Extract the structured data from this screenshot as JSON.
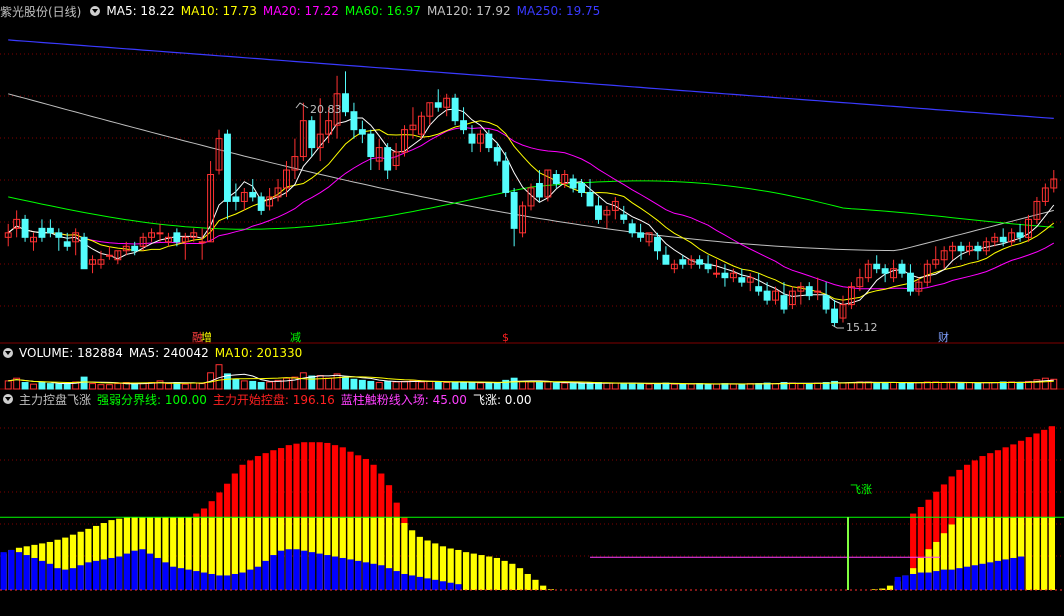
{
  "price_header": {
    "title": "紫光股份(日线)",
    "ma": [
      {
        "label": "MA5: 18.22",
        "color": "#ffffff"
      },
      {
        "label": "MA10: 17.73",
        "color": "#ffff00"
      },
      {
        "label": "MA20: 17.22",
        "color": "#ff00ff"
      },
      {
        "label": "MA60: 16.97",
        "color": "#00ff00"
      },
      {
        "label": "MA120: 17.92",
        "color": "#c0c0c0"
      },
      {
        "label": "MA250: 19.75",
        "color": "#3a3aff"
      }
    ]
  },
  "volume_header": {
    "ma": [
      {
        "label": "VOLUME: 182884",
        "color": "#ffffff"
      },
      {
        "label": "MA5: 240042",
        "color": "#ffffff"
      },
      {
        "label": "MA10: 201330",
        "color": "#ffff00"
      }
    ]
  },
  "indicator_header": {
    "title": "主力控盘飞涨",
    "items": [
      {
        "label": "强弱分界线: 100.00",
        "color": "#00ff00"
      },
      {
        "label": "主力开始控盘: 196.16",
        "color": "#ff2020"
      },
      {
        "label": "蓝柱触粉线入场: 45.00",
        "color": "#ff40ff"
      },
      {
        "label": "飞涨: 0.00",
        "color": "#ffffff"
      }
    ]
  },
  "annotations": {
    "high_label": "20.83",
    "low_label": "15.12",
    "markers": [
      {
        "text": "融",
        "color": "#ff4040"
      },
      {
        "text": "增",
        "color": "#ffff00"
      },
      {
        "text": "减",
        "color": "#00ff00"
      },
      {
        "text": "$",
        "color": "#ff2020"
      },
      {
        "text": "财",
        "color": "#80a0ff"
      }
    ],
    "feizhang": "飞涨"
  },
  "colors": {
    "up": "#ff3232",
    "down": "#54fcfc",
    "red_bar": "#ff0000",
    "yellow_bar": "#ffff00",
    "blue_bar": "#0000ff",
    "grid": "#7f0000"
  },
  "chart_data": [
    {
      "type": "candlestick",
      "name": "紫光股份(日线)",
      "ylim": [
        14.9,
        21.9
      ],
      "candles": [
        [
          17.1,
          17.4,
          16.9,
          17.2
        ],
        [
          17.3,
          17.7,
          17.1,
          17.5
        ],
        [
          17.5,
          17.6,
          17.0,
          17.1
        ],
        [
          17.0,
          17.2,
          16.8,
          17.1
        ],
        [
          17.3,
          17.5,
          17.0,
          17.1
        ],
        [
          17.3,
          17.5,
          17.1,
          17.2
        ],
        [
          17.2,
          17.3,
          16.8,
          17.1
        ],
        [
          17.0,
          17.2,
          16.8,
          16.9
        ],
        [
          17.0,
          17.3,
          16.7,
          17.2
        ],
        [
          17.1,
          17.2,
          16.4,
          16.4
        ],
        [
          16.5,
          16.7,
          16.3,
          16.6
        ],
        [
          16.5,
          16.8,
          16.4,
          16.6
        ],
        [
          16.7,
          16.9,
          16.6,
          16.7
        ],
        [
          16.6,
          16.8,
          16.5,
          16.8
        ],
        [
          16.8,
          17.0,
          16.7,
          16.9
        ],
        [
          16.9,
          17.0,
          16.7,
          16.8
        ],
        [
          16.9,
          17.2,
          16.8,
          17.1
        ],
        [
          17.1,
          17.3,
          17.0,
          17.2
        ],
        [
          17.2,
          17.4,
          17.0,
          17.2
        ],
        [
          17.0,
          17.2,
          16.9,
          17.1
        ],
        [
          17.2,
          17.3,
          16.9,
          17.0
        ],
        [
          17.0,
          17.2,
          16.6,
          17.1
        ],
        [
          17.1,
          17.3,
          17.0,
          17.2
        ],
        [
          17.0,
          17.3,
          16.6,
          17.0
        ],
        [
          17.0,
          18.8,
          17.0,
          18.5
        ],
        [
          18.6,
          19.5,
          18.5,
          19.3
        ],
        [
          19.4,
          19.5,
          17.5,
          17.9
        ],
        [
          18.0,
          18.3,
          17.7,
          17.9
        ],
        [
          17.9,
          18.2,
          17.7,
          18.1
        ],
        [
          18.1,
          18.4,
          17.9,
          18.0
        ],
        [
          18.0,
          18.1,
          17.6,
          17.7
        ],
        [
          17.8,
          18.2,
          17.7,
          18.0
        ],
        [
          18.0,
          18.4,
          17.9,
          18.2
        ],
        [
          18.2,
          18.8,
          18.0,
          18.6
        ],
        [
          18.6,
          19.3,
          18.4,
          18.9
        ],
        [
          18.9,
          20.1,
          18.8,
          19.7
        ],
        [
          19.7,
          19.8,
          18.9,
          19.1
        ],
        [
          19.1,
          20.2,
          18.8,
          19.4
        ],
        [
          19.4,
          20.0,
          19.2,
          19.7
        ],
        [
          19.6,
          20.7,
          19.3,
          20.3
        ],
        [
          20.3,
          20.8,
          19.8,
          19.9
        ],
        [
          19.9,
          20.1,
          19.3,
          19.5
        ],
        [
          19.5,
          19.7,
          19.2,
          19.4
        ],
        [
          19.4,
          19.5,
          18.6,
          18.9
        ],
        [
          18.8,
          19.3,
          18.6,
          19.1
        ],
        [
          19.1,
          19.2,
          18.4,
          18.6
        ],
        [
          18.7,
          19.2,
          18.6,
          19.0
        ],
        [
          19.0,
          19.6,
          18.9,
          19.5
        ],
        [
          19.5,
          20.0,
          19.3,
          19.6
        ],
        [
          19.4,
          19.9,
          19.3,
          19.8
        ],
        [
          19.8,
          20.1,
          19.6,
          20.1
        ],
        [
          20.1,
          20.4,
          19.9,
          20.0
        ],
        [
          20.0,
          20.3,
          19.8,
          20.2
        ],
        [
          20.2,
          20.3,
          19.6,
          19.7
        ],
        [
          19.7,
          20.0,
          19.4,
          19.5
        ],
        [
          19.4,
          19.6,
          19.0,
          19.2
        ],
        [
          19.2,
          19.5,
          19.0,
          19.4
        ],
        [
          19.4,
          19.5,
          19.0,
          19.1
        ],
        [
          19.1,
          19.2,
          18.7,
          18.8
        ],
        [
          18.8,
          19.0,
          18.0,
          18.1
        ],
        [
          18.1,
          18.2,
          16.9,
          17.3
        ],
        [
          17.2,
          17.9,
          17.1,
          17.8
        ],
        [
          17.8,
          18.3,
          17.7,
          18.2
        ],
        [
          18.3,
          18.6,
          17.9,
          18.0
        ],
        [
          18.0,
          18.6,
          17.9,
          18.6
        ],
        [
          18.5,
          18.6,
          18.2,
          18.3
        ],
        [
          18.3,
          18.6,
          18.2,
          18.5
        ],
        [
          18.4,
          18.5,
          18.1,
          18.2
        ],
        [
          18.3,
          18.4,
          18.0,
          18.1
        ],
        [
          18.1,
          18.4,
          17.9,
          17.8
        ],
        [
          17.8,
          18.0,
          17.4,
          17.5
        ],
        [
          17.6,
          17.8,
          17.3,
          17.7
        ],
        [
          17.7,
          18.0,
          17.5,
          17.9
        ],
        [
          17.6,
          17.8,
          17.4,
          17.5
        ],
        [
          17.4,
          17.5,
          17.1,
          17.2
        ],
        [
          17.2,
          17.4,
          17.0,
          17.1
        ],
        [
          17.0,
          17.2,
          16.9,
          17.2
        ],
        [
          17.1,
          17.2,
          16.6,
          16.8
        ],
        [
          16.7,
          16.9,
          16.5,
          16.5
        ],
        [
          16.4,
          16.6,
          16.3,
          16.5
        ],
        [
          16.6,
          16.7,
          16.4,
          16.5
        ],
        [
          16.5,
          16.7,
          16.4,
          16.6
        ],
        [
          16.6,
          16.7,
          16.4,
          16.5
        ],
        [
          16.5,
          16.7,
          16.3,
          16.4
        ],
        [
          16.3,
          16.6,
          16.2,
          16.3
        ],
        [
          16.3,
          16.5,
          16.0,
          16.2
        ],
        [
          16.2,
          16.4,
          16.1,
          16.3
        ],
        [
          16.2,
          16.4,
          16.0,
          16.1
        ],
        [
          16.1,
          16.3,
          15.9,
          16.2
        ],
        [
          16.0,
          16.3,
          15.8,
          15.9
        ],
        [
          15.9,
          16.1,
          15.6,
          15.7
        ],
        [
          15.7,
          16.0,
          15.6,
          15.9
        ],
        [
          15.8,
          16.1,
          15.4,
          15.5
        ],
        [
          15.6,
          16.0,
          15.5,
          15.9
        ],
        [
          15.9,
          16.1,
          15.6,
          16.0
        ],
        [
          16.0,
          16.1,
          15.7,
          15.8
        ],
        [
          15.9,
          16.2,
          15.7,
          15.9
        ],
        [
          15.8,
          16.1,
          15.4,
          15.5
        ],
        [
          15.5,
          15.7,
          15.1,
          15.2
        ],
        [
          15.3,
          15.8,
          15.2,
          15.6
        ],
        [
          15.6,
          16.1,
          15.5,
          16.0
        ],
        [
          16.0,
          16.4,
          15.9,
          16.2
        ],
        [
          16.2,
          16.6,
          16.1,
          16.5
        ],
        [
          16.5,
          16.7,
          16.3,
          16.4
        ],
        [
          16.4,
          16.5,
          16.1,
          16.3
        ],
        [
          16.2,
          16.6,
          16.1,
          16.4
        ],
        [
          16.5,
          16.6,
          16.2,
          16.3
        ],
        [
          16.3,
          16.5,
          15.8,
          15.9
        ],
        [
          15.9,
          16.2,
          15.8,
          16.1
        ],
        [
          16.1,
          16.6,
          16.0,
          16.5
        ],
        [
          16.5,
          16.9,
          16.4,
          16.6
        ],
        [
          16.6,
          16.9,
          16.4,
          16.8
        ],
        [
          16.8,
          17.0,
          16.6,
          16.9
        ],
        [
          16.9,
          17.0,
          16.6,
          16.8
        ],
        [
          16.8,
          17.0,
          16.7,
          16.9
        ],
        [
          16.9,
          17.0,
          16.6,
          16.8
        ],
        [
          16.8,
          17.1,
          16.7,
          17.0
        ],
        [
          17.0,
          17.2,
          16.9,
          17.1
        ],
        [
          17.1,
          17.3,
          16.9,
          17.0
        ],
        [
          17.0,
          17.3,
          16.9,
          17.2
        ],
        [
          17.2,
          17.4,
          17.0,
          17.1
        ],
        [
          17.1,
          17.6,
          17.0,
          17.5
        ],
        [
          17.5,
          18.0,
          17.4,
          17.9
        ],
        [
          17.9,
          18.3,
          17.8,
          18.2
        ],
        [
          18.2,
          18.6,
          18.1,
          18.4
        ]
      ],
      "ma5_last": 18.22,
      "ma10_last": 17.73,
      "ma20_last": 17.22,
      "ma60_last": 16.97,
      "ma120_last": 17.92,
      "ma250_last": 19.75,
      "high": 20.83,
      "low": 15.12
    },
    {
      "type": "bar",
      "name": "VOLUME",
      "last": 182884,
      "ma5": 240042,
      "ma10": 201330,
      "values": [
        15,
        20,
        12,
        9,
        12,
        10,
        9,
        10,
        13,
        22,
        10,
        8,
        8,
        10,
        12,
        10,
        10,
        12,
        15,
        10,
        12,
        9,
        11,
        10,
        30,
        45,
        28,
        18,
        15,
        14,
        12,
        13,
        16,
        20,
        22,
        30,
        24,
        25,
        20,
        28,
        22,
        18,
        16,
        14,
        12,
        14,
        13,
        14,
        16,
        13,
        14,
        13,
        12,
        13,
        12,
        12,
        11,
        11,
        12,
        16,
        20,
        14,
        13,
        12,
        13,
        11,
        11,
        10,
        10,
        11,
        12,
        11,
        11,
        10,
        11,
        10,
        9,
        10,
        11,
        9,
        9,
        9,
        10,
        9,
        9,
        10,
        9,
        9,
        10,
        10,
        11,
        10,
        12,
        11,
        10,
        10,
        11,
        12,
        14,
        11,
        12,
        13,
        13,
        12,
        11,
        12,
        11,
        11,
        12,
        13,
        13,
        12,
        12,
        11,
        12,
        11,
        12,
        12,
        13,
        13,
        12,
        14,
        17,
        20,
        18
      ]
    },
    {
      "type": "bar",
      "name": "主力控盘飞涨",
      "lines": {
        "强弱分界线": 100,
        "蓝柱触粉线入场": 45
      },
      "ylim": [
        0,
        230
      ],
      "red": [
        0,
        0,
        0,
        0,
        0,
        0,
        0,
        0,
        0,
        0,
        0,
        0,
        0,
        0,
        0,
        0,
        0,
        0,
        0,
        0,
        0,
        0,
        0,
        0,
        0,
        105,
        112,
        122,
        134,
        146,
        160,
        172,
        178,
        184,
        188,
        192,
        195,
        199,
        201,
        203,
        203,
        203,
        202,
        199,
        196,
        190,
        185,
        180,
        172,
        160,
        144,
        120,
        100,
        0,
        0,
        0,
        0,
        0,
        0,
        0,
        0,
        0,
        0,
        0,
        0,
        0,
        0,
        0,
        0,
        0,
        0,
        0,
        0,
        0,
        0,
        0,
        0,
        0,
        0,
        0,
        0,
        0,
        0,
        0,
        0,
        0,
        0,
        0,
        0,
        0,
        0,
        0,
        0,
        0,
        0,
        0,
        0,
        0,
        0,
        0,
        0,
        0,
        0,
        0,
        0,
        0,
        0,
        0,
        0,
        0,
        0,
        0,
        0,
        0,
        0,
        0,
        0,
        0,
        105,
        114,
        124,
        135,
        145,
        156,
        165,
        172,
        178,
        184,
        188,
        192,
        196,
        200,
        205,
        210,
        215,
        220,
        225,
        230,
        236,
        240,
        246,
        250,
        250,
        250,
        250,
        250,
        250,
        250,
        250,
        250,
        250
      ],
      "yellow": [
        50,
        55,
        58,
        60,
        62,
        64,
        66,
        69,
        72,
        76,
        80,
        84,
        88,
        92,
        96,
        98,
        100,
        100,
        100,
        100,
        100,
        100,
        100,
        100,
        100,
        100,
        100,
        100,
        100,
        100,
        100,
        100,
        100,
        100,
        100,
        100,
        100,
        100,
        100,
        100,
        100,
        100,
        100,
        100,
        100,
        100,
        100,
        100,
        100,
        100,
        100,
        100,
        92,
        82,
        73,
        68,
        64,
        60,
        57,
        55,
        52,
        50,
        48,
        46,
        44,
        40,
        36,
        30,
        22,
        14,
        6,
        1,
        0,
        0,
        0,
        0,
        0,
        0,
        0,
        0,
        0,
        0,
        0,
        0,
        0,
        0,
        0,
        0,
        0,
        0,
        0,
        0,
        0,
        0,
        0,
        0,
        0,
        0,
        0,
        0,
        0,
        0,
        0,
        0,
        0,
        0,
        0,
        0,
        0,
        0,
        0,
        0,
        0,
        1,
        2,
        6,
        12,
        20,
        30,
        44,
        56,
        66,
        78,
        90,
        100,
        100,
        100,
        100,
        100,
        100,
        100,
        100,
        100,
        100,
        100,
        100,
        100
      ],
      "blue": [
        52,
        55,
        52,
        48,
        44,
        40,
        36,
        30,
        28,
        30,
        34,
        38,
        40,
        42,
        44,
        46,
        50,
        54,
        56,
        50,
        44,
        38,
        32,
        30,
        28,
        26,
        24,
        22,
        20,
        20,
        22,
        24,
        28,
        32,
        40,
        48,
        54,
        56,
        56,
        54,
        52,
        50,
        48,
        46,
        44,
        42,
        40,
        38,
        36,
        34,
        30,
        26,
        22,
        20,
        18,
        16,
        14,
        12,
        10,
        8,
        0,
        0,
        0,
        0,
        0,
        0,
        0,
        0,
        0,
        0,
        0,
        0,
        0,
        0,
        0,
        0,
        0,
        0,
        0,
        0,
        0,
        0,
        0,
        0,
        0,
        0,
        0,
        0,
        0,
        0,
        0,
        0,
        0,
        0,
        0,
        0,
        0,
        0,
        0,
        0,
        0,
        0,
        0,
        0,
        0,
        0,
        0,
        0,
        0,
        0,
        0,
        0,
        0,
        0,
        0,
        0,
        18,
        20,
        22,
        24,
        24,
        26,
        28,
        28,
        30,
        32,
        34,
        36,
        38,
        40,
        42,
        44,
        46
      ]
    }
  ]
}
